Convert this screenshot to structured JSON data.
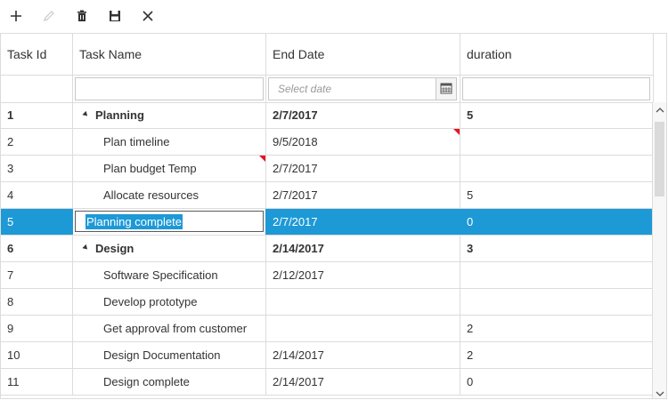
{
  "toolbar": {
    "add_icon": "plus-icon",
    "edit_icon": "pencil-icon",
    "delete_icon": "trash-icon",
    "save_icon": "floppy-disk-icon",
    "cancel_icon": "close-icon"
  },
  "columns": [
    "Task Id",
    "Task Name",
    "End Date",
    "duration"
  ],
  "filter": {
    "date_placeholder": "Select date",
    "calendar_icon": "calendar-icon"
  },
  "rows": [
    {
      "id": "1",
      "name": "Planning",
      "end": "2/7/2017",
      "duration": "5"
    },
    {
      "id": "2",
      "name": "Plan timeline",
      "end": "9/5/2018",
      "duration": ""
    },
    {
      "id": "3",
      "name": "Plan budget Temp",
      "end": "2/7/2017",
      "duration": ""
    },
    {
      "id": "4",
      "name": "Allocate resources",
      "end": "2/7/2017",
      "duration": "5"
    },
    {
      "id": "5",
      "name": "Planning complete",
      "end": "2/7/2017",
      "duration": "0"
    },
    {
      "id": "6",
      "name": "Design",
      "end": "2/14/2017",
      "duration": "3"
    },
    {
      "id": "7",
      "name": "Software Specification",
      "end": "2/12/2017",
      "duration": ""
    },
    {
      "id": "8",
      "name": "Develop prototype",
      "end": "",
      "duration": ""
    },
    {
      "id": "9",
      "name": "Get approval from customer",
      "end": "",
      "duration": "2"
    },
    {
      "id": "10",
      "name": "Design Documentation",
      "end": "2/14/2017",
      "duration": "2"
    },
    {
      "id": "11",
      "name": "Design complete",
      "end": "2/14/2017",
      "duration": "0"
    }
  ],
  "colors": {
    "selected": "#1d99d6",
    "dirty_marker": "#e81123",
    "border": "#dcdcdc"
  }
}
